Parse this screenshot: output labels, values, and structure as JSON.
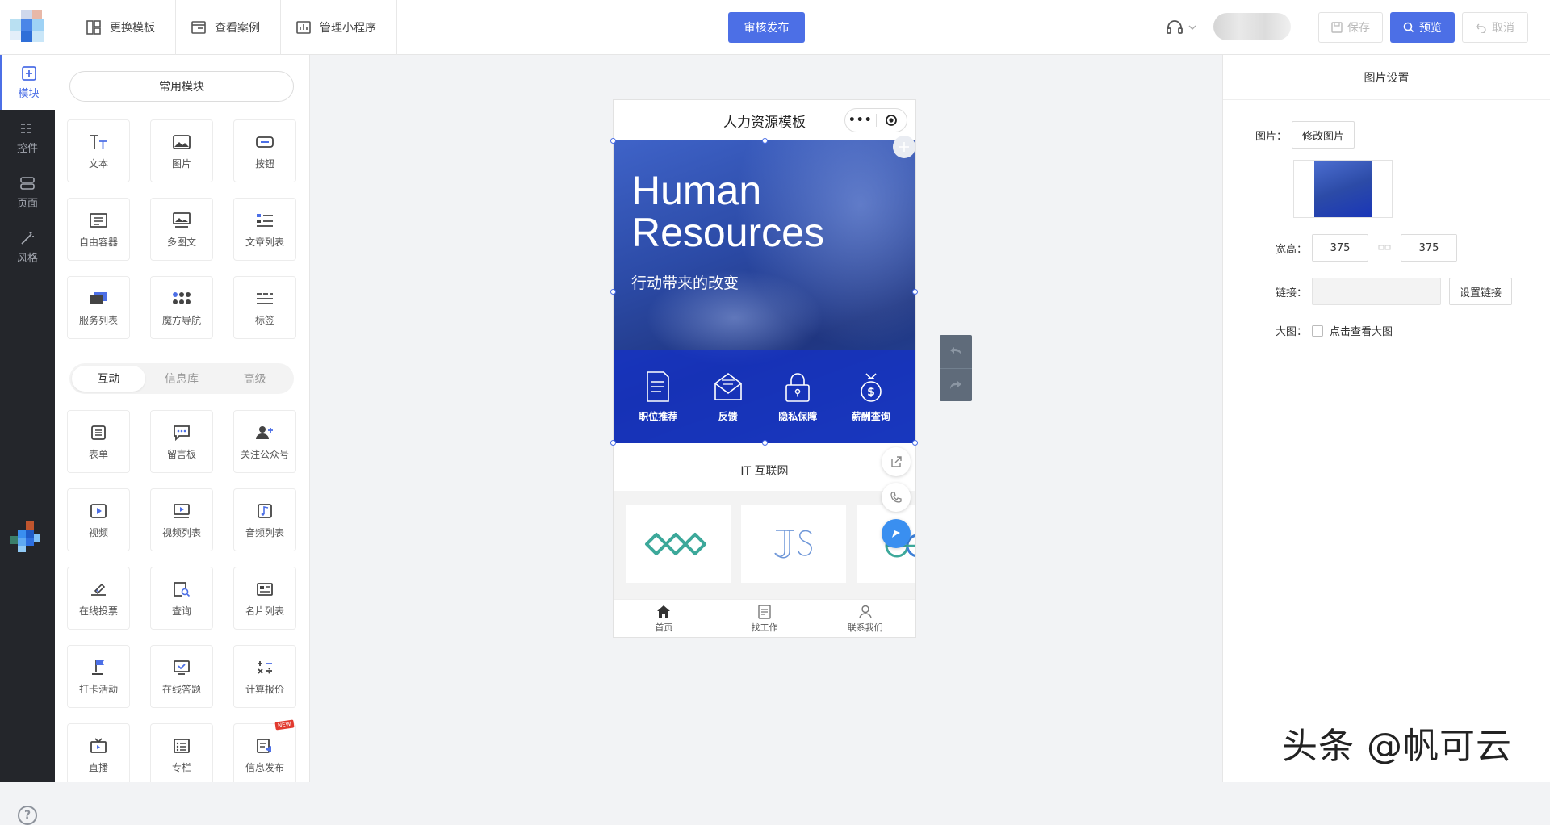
{
  "topbar": {
    "nav": [
      {
        "label": "更换模板",
        "icon": "template-icon"
      },
      {
        "label": "查看案例",
        "icon": "case-icon"
      },
      {
        "label": "管理小程序",
        "icon": "chart-icon"
      }
    ],
    "publish_label": "审核发布",
    "save_label": "保存",
    "preview_label": "预览",
    "cancel_label": "取消",
    "accent": "#4c6fe6"
  },
  "leftbar": {
    "items": [
      {
        "label": "模块",
        "icon": "plus-square-icon",
        "active": true
      },
      {
        "label": "控件",
        "icon": "sliders-icon"
      },
      {
        "label": "页面",
        "icon": "pages-icon"
      },
      {
        "label": "风格",
        "icon": "magic-wand-icon"
      }
    ],
    "help": "?"
  },
  "panel": {
    "common_title": "常用模块",
    "common": [
      {
        "label": "文本",
        "icon": "text-icon"
      },
      {
        "label": "图片",
        "icon": "image-icon"
      },
      {
        "label": "按钮",
        "icon": "button-icon"
      },
      {
        "label": "自由容器",
        "icon": "container-icon"
      },
      {
        "label": "多图文",
        "icon": "multi-image-icon"
      },
      {
        "label": "文章列表",
        "icon": "article-list-icon"
      },
      {
        "label": "服务列表",
        "icon": "service-list-icon"
      },
      {
        "label": "魔方导航",
        "icon": "cube-nav-icon"
      },
      {
        "label": "标签",
        "icon": "tabs-icon"
      }
    ],
    "tabs": [
      "互动",
      "信息库",
      "高级"
    ],
    "interactive": [
      {
        "label": "表单",
        "icon": "form-icon"
      },
      {
        "label": "留言板",
        "icon": "message-board-icon"
      },
      {
        "label": "关注公众号",
        "icon": "follow-icon"
      },
      {
        "label": "视频",
        "icon": "video-icon"
      },
      {
        "label": "视频列表",
        "icon": "video-list-icon"
      },
      {
        "label": "音频列表",
        "icon": "audio-list-icon"
      },
      {
        "label": "在线投票",
        "icon": "vote-icon"
      },
      {
        "label": "查询",
        "icon": "query-icon"
      },
      {
        "label": "名片列表",
        "icon": "card-list-icon"
      },
      {
        "label": "打卡活动",
        "icon": "checkin-icon"
      },
      {
        "label": "在线答题",
        "icon": "quiz-icon"
      },
      {
        "label": "计算报价",
        "icon": "calculator-icon"
      },
      {
        "label": "直播",
        "icon": "live-icon"
      },
      {
        "label": "专栏",
        "icon": "column-icon"
      },
      {
        "label": "信息发布",
        "icon": "publish-icon",
        "badge": "NEW"
      }
    ]
  },
  "phone": {
    "title": "人力资源模板",
    "capsule_dots": "•••",
    "hero_title_line1": "Human",
    "hero_title_line2": "Resources",
    "hero_subtitle": "行动带来的改变",
    "hero_items": [
      "职位推荐",
      "反馈",
      "隐私保障",
      "薪酬查询"
    ],
    "section_title": "IT 互联网",
    "tabbar": [
      "首页",
      "找工作",
      "联系我们"
    ]
  },
  "rpanel": {
    "title": "图片设置",
    "image_label": "图片：",
    "change_image": "修改图片",
    "size_label": "宽高：",
    "width": "375",
    "height": "375",
    "link_label": "链接：",
    "set_link": "设置链接",
    "bigimg_label": "大图：",
    "bigimg_option": "点击查看大图"
  },
  "watermark": "头条 @帆可云"
}
